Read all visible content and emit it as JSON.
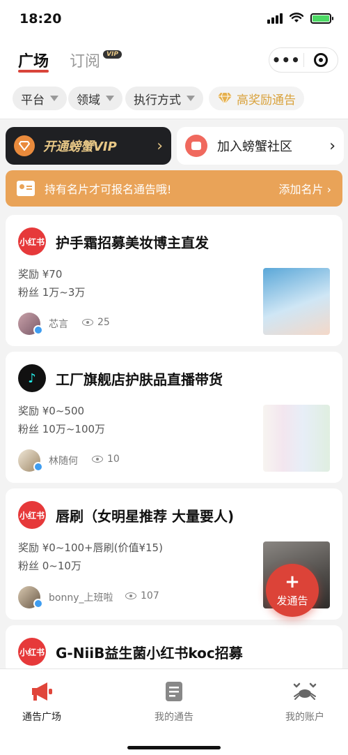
{
  "status_bar": {
    "time": "18:20"
  },
  "header": {
    "tabs": [
      {
        "label": "广场",
        "active": true
      },
      {
        "label": "订阅",
        "active": false
      }
    ],
    "vip_badge": "VIP",
    "capsule_more": "•••"
  },
  "filters": {
    "items": [
      {
        "label": "平台"
      },
      {
        "label": "领域"
      },
      {
        "label": "执行方式"
      }
    ],
    "reward_filter": "高奖励通告"
  },
  "banners": {
    "vip": {
      "label": "开通螃蟹VIP",
      "chevron": "›"
    },
    "community": {
      "label": "加入螃蟹社区",
      "chevron": "›"
    }
  },
  "card_notice": {
    "text": "持有名片才可报名通告哦!",
    "action": "添加名片 ›"
  },
  "jobs": [
    {
      "platform": "小红书",
      "title": "护手霜招募美妆博主直发",
      "reward": "奖励  ¥70",
      "fans": "粉丝  1万~3万",
      "author": "芯言",
      "views": "25"
    },
    {
      "platform": "抖音",
      "title": "工厂旗舰店护肤品直播带货",
      "reward": "奖励  ¥0~500",
      "fans": "粉丝  10万~100万",
      "author": "林随何",
      "views": "10"
    },
    {
      "platform": "小红书",
      "title": "唇刷（女明星推荐 大量要人)",
      "reward": "奖励  ¥0~100+唇刷(价值¥15)",
      "fans": "粉丝  0~10万",
      "author": "bonny_上班啦",
      "views": "107"
    },
    {
      "platform": "小红书",
      "title": "G-NiiB益生菌小红书koc招募"
    }
  ],
  "fab": {
    "plus": "+",
    "label": "发通告"
  },
  "tabbar": [
    {
      "label": "通告广场",
      "active": true
    },
    {
      "label": "我的通告",
      "active": false
    },
    {
      "label": "我的账户",
      "active": false
    }
  ],
  "colors": {
    "accent": "#dc4338",
    "gold": "#e7c786",
    "notice": "#e9a358"
  }
}
